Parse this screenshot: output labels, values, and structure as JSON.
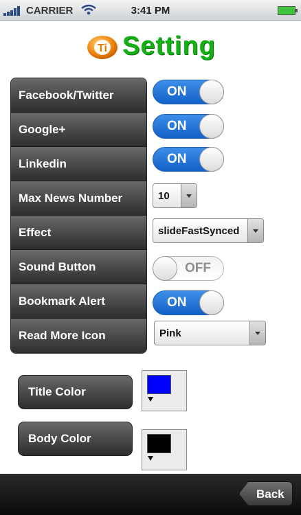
{
  "status_bar": {
    "carrier": "CARRIER",
    "time": "3:41 PM"
  },
  "header": {
    "title": "Setting",
    "logo_icon": "ti-logo-icon"
  },
  "settings": [
    {
      "label": "Facebook/Twitter",
      "control": "toggle",
      "value": "ON"
    },
    {
      "label": "Google+",
      "control": "toggle",
      "value": "ON"
    },
    {
      "label": "Linkedin",
      "control": "toggle",
      "value": "ON"
    },
    {
      "label": "Max News Number",
      "control": "select",
      "value": "10"
    },
    {
      "label": "Effect",
      "control": "select",
      "value": "slideFastSynced"
    },
    {
      "label": "Sound Button",
      "control": "toggle",
      "value": "OFF"
    },
    {
      "label": "Bookmark Alert",
      "control": "toggle",
      "value": "ON"
    },
    {
      "label": "Read More Icon",
      "control": "select",
      "value": "Pink"
    }
  ],
  "colors": {
    "title_color_label": "Title Color",
    "title_color_value": "#0000ff",
    "body_color_label": "Body Color",
    "body_color_value": "#000000",
    "accent_green": "#14b014",
    "toggle_blue": "#1261c8"
  },
  "footer": {
    "back_label": "Back"
  }
}
